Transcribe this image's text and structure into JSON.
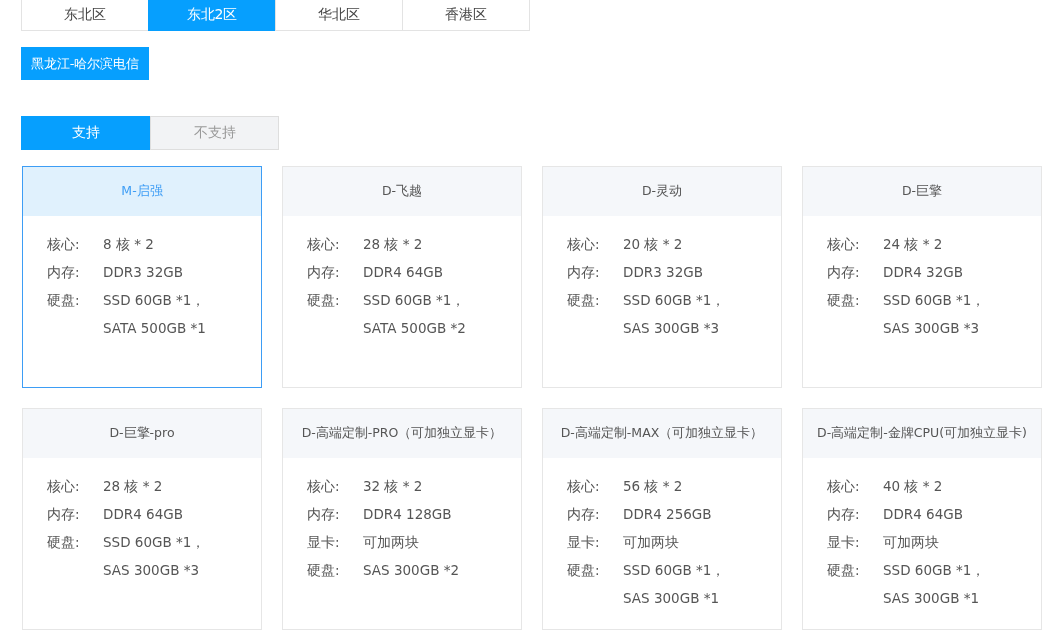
{
  "region_tabs": [
    {
      "label": "东北区",
      "selected": false
    },
    {
      "label": "东北2区",
      "selected": true
    },
    {
      "label": "华北区",
      "selected": false
    },
    {
      "label": "香港区",
      "selected": false
    }
  ],
  "datacenters": [
    {
      "label": "黑龙江-哈尔滨电信",
      "selected": true
    }
  ],
  "support_tabs": [
    {
      "label": "支持",
      "selected": true
    },
    {
      "label": "不支持",
      "selected": false
    }
  ],
  "plans": [
    {
      "name": "M-启强",
      "selected": true,
      "specs": [
        {
          "label": "核心:",
          "values": [
            "8 核 * 2"
          ]
        },
        {
          "label": "内存:",
          "values": [
            "DDR3 32GB"
          ]
        },
        {
          "label": "硬盘:",
          "values": [
            "SSD 60GB *1，",
            "SATA 500GB *1"
          ]
        }
      ]
    },
    {
      "name": "D-飞越",
      "selected": false,
      "specs": [
        {
          "label": "核心:",
          "values": [
            "28 核 * 2"
          ]
        },
        {
          "label": "内存:",
          "values": [
            "DDR4 64GB"
          ]
        },
        {
          "label": "硬盘:",
          "values": [
            "SSD 60GB *1，",
            "SATA 500GB *2"
          ]
        }
      ]
    },
    {
      "name": "D-灵动",
      "selected": false,
      "specs": [
        {
          "label": "核心:",
          "values": [
            "20 核 * 2"
          ]
        },
        {
          "label": "内存:",
          "values": [
            "DDR3 32GB"
          ]
        },
        {
          "label": "硬盘:",
          "values": [
            "SSD 60GB *1，",
            "SAS 300GB *3"
          ]
        }
      ]
    },
    {
      "name": "D-巨擎",
      "selected": false,
      "specs": [
        {
          "label": "核心:",
          "values": [
            "24 核 * 2"
          ]
        },
        {
          "label": "内存:",
          "values": [
            "DDR4 32GB"
          ]
        },
        {
          "label": "硬盘:",
          "values": [
            "SSD 60GB *1，",
            "SAS 300GB *3"
          ]
        }
      ]
    },
    {
      "name": "D-巨擎-pro",
      "selected": false,
      "specs": [
        {
          "label": "核心:",
          "values": [
            "28 核 * 2"
          ]
        },
        {
          "label": "内存:",
          "values": [
            "DDR4 64GB"
          ]
        },
        {
          "label": "硬盘:",
          "values": [
            "SSD 60GB *1，",
            "SAS 300GB *3"
          ]
        }
      ]
    },
    {
      "name": "D-高端定制-PRO（可加独立显卡）",
      "selected": false,
      "specs": [
        {
          "label": "核心:",
          "values": [
            "32 核 * 2"
          ]
        },
        {
          "label": "内存:",
          "values": [
            "DDR4 128GB"
          ]
        },
        {
          "label": "显卡:",
          "values": [
            "可加两块"
          ]
        },
        {
          "label": "硬盘:",
          "values": [
            "SAS 300GB *2"
          ]
        }
      ]
    },
    {
      "name": "D-高端定制-MAX（可加独立显卡）",
      "selected": false,
      "specs": [
        {
          "label": "核心:",
          "values": [
            "56 核 * 2"
          ]
        },
        {
          "label": "内存:",
          "values": [
            "DDR4 256GB"
          ]
        },
        {
          "label": "显卡:",
          "values": [
            "可加两块"
          ]
        },
        {
          "label": "硬盘:",
          "values": [
            "SSD 60GB *1，",
            "SAS 300GB *1"
          ]
        }
      ]
    },
    {
      "name": "D-高端定制-金牌CPU(可加独立显卡)",
      "selected": false,
      "specs": [
        {
          "label": "核心:",
          "values": [
            "40 核 * 2"
          ]
        },
        {
          "label": "内存:",
          "values": [
            "DDR4 64GB"
          ]
        },
        {
          "label": "显卡:",
          "values": [
            "可加两块"
          ]
        },
        {
          "label": "硬盘:",
          "values": [
            "SSD 60GB *1，",
            "SAS 300GB *1"
          ]
        }
      ]
    }
  ]
}
